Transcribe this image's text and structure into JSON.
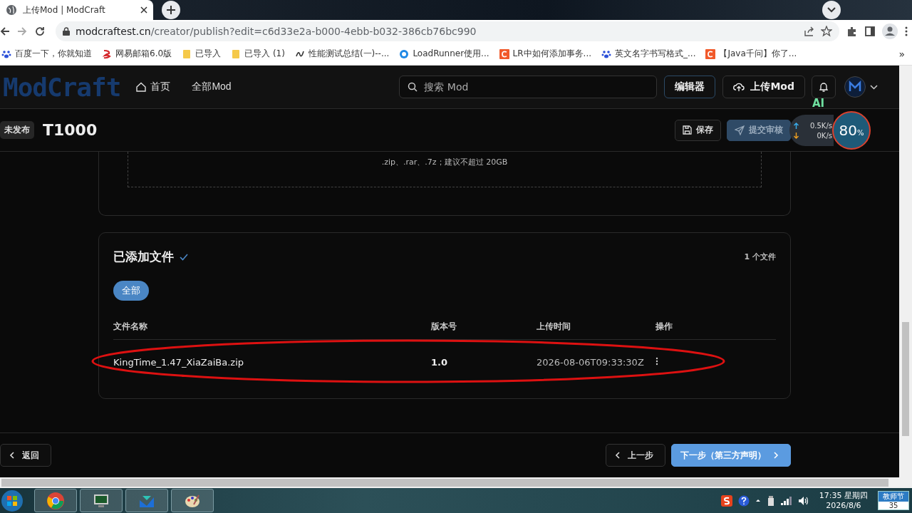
{
  "browser": {
    "tab": {
      "title": "上传Mod | ModCraft"
    },
    "address": {
      "host": "modcraftest.cn",
      "path": "/creator/publish?edit=c6d33e2a-b000-4ebb-b032-386cb76bc990"
    },
    "bookmarks": [
      {
        "kind": "paw",
        "label": "百度一下，你就知道"
      },
      {
        "kind": "mail",
        "label": "网易邮箱6.0版"
      },
      {
        "kind": "folder",
        "label": "已导入"
      },
      {
        "kind": "folder",
        "label": "已导入 (1)"
      },
      {
        "kind": "perf",
        "label": "性能测试总结(一)--..."
      },
      {
        "kind": "ring",
        "label": "LoadRunner使用..."
      },
      {
        "kind": "letter",
        "label": "LR中如何添加事务..."
      },
      {
        "kind": "paw",
        "label": "英文名字书写格式_..."
      },
      {
        "kind": "letter",
        "label": "【Java千问】你了..."
      }
    ],
    "more_bookmarks": "»"
  },
  "header": {
    "logo": "ModCraft",
    "nav": [
      {
        "label": "首页",
        "kind": "home"
      },
      {
        "label": "全部Mod",
        "kind": "plain"
      }
    ],
    "search": {
      "placeholder": "搜索 Mod"
    },
    "editor_button": "编辑器",
    "upload_button": "上传Mod"
  },
  "subheader": {
    "status": "未发布",
    "title": "T1000",
    "save_button": "保存",
    "submit_button": "提交审核",
    "submit_disabled": true
  },
  "net_widget": {
    "badge": "AI",
    "upload_speed": "0.5K/s",
    "download_speed": "0K/s",
    "gauge_value": "80",
    "gauge_unit": "%"
  },
  "upload_area": {
    "hint": ".zip、.rar、.7z；建议不超过 20GB"
  },
  "files": {
    "title": "已添加文件",
    "count": "1 个文件",
    "filters": [
      {
        "label": "全部",
        "selected": true
      }
    ],
    "columns": [
      "文件名称",
      "版本号",
      "上传时间",
      "操作"
    ],
    "rows": [
      {
        "name": "KingTime_1.47_XiaZaiBa.zip",
        "version": "1.0",
        "uploaded": "2026-08-06T09:33:30Z",
        "highlighted": true
      }
    ]
  },
  "footer": {
    "back_button": "返回",
    "prev_button": "上一步",
    "next_button": "下一步（第三方声明）"
  },
  "taskbar": {
    "time": "17:35 星期四",
    "date": "2026/8/6",
    "calendar_label": "教师节",
    "calendar_day": "35"
  }
}
